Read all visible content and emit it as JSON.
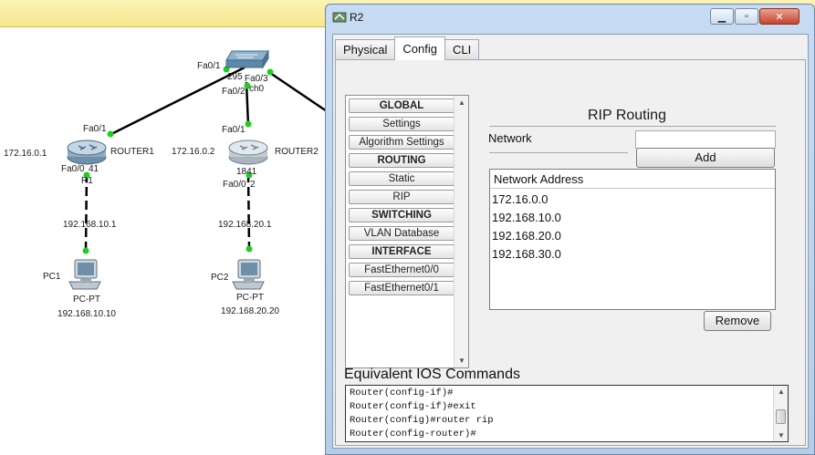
{
  "dialog": {
    "title": "R2",
    "tabs": [
      "Physical",
      "Config",
      "CLI"
    ],
    "active_tab": "Config"
  },
  "nav": {
    "items": [
      {
        "label": "GLOBAL",
        "header": true
      },
      {
        "label": "Settings",
        "header": false
      },
      {
        "label": "Algorithm Settings",
        "header": false
      },
      {
        "label": "ROUTING",
        "header": true
      },
      {
        "label": "Static",
        "header": false
      },
      {
        "label": "RIP",
        "header": false
      },
      {
        "label": "SWITCHING",
        "header": true
      },
      {
        "label": "VLAN Database",
        "header": false
      },
      {
        "label": "INTERFACE",
        "header": true
      },
      {
        "label": "FastEthernet0/0",
        "header": false
      },
      {
        "label": "FastEthernet0/1",
        "header": false
      }
    ]
  },
  "rip": {
    "title": "RIP Routing",
    "network_label": "Network",
    "network_value": "",
    "add_label": "Add",
    "list_header": "Network Address",
    "networks": [
      "172.16.0.0",
      "192.168.10.0",
      "192.168.20.0",
      "192.168.30.0"
    ],
    "remove_label": "Remove"
  },
  "ios": {
    "title": "Equivalent IOS Commands",
    "lines": [
      "Router(config-if)#",
      "Router(config-if)#exit",
      "Router(config)#router rip",
      "Router(config-router)#"
    ]
  },
  "topology": {
    "switch": {
      "name": "295",
      "name2": "ch0",
      "ports": [
        "Fa0/1",
        "Fa0/3",
        "Fa0/2"
      ]
    },
    "router1": {
      "name": "ROUTER1",
      "ip": "172.16.0.1",
      "port_top": "Fa0/1",
      "port_bottom": "Fa0/0",
      "model": "41",
      "model2": "R1"
    },
    "router2": {
      "name": "ROUTER2",
      "ip": "172.16.0.2",
      "port_top": "Fa0/1",
      "port_bottom": "Fa0/0",
      "model": "1841",
      "model2": "2"
    },
    "link1_ip": "192.168.10.1",
    "link2_ip": "192.168.20.1",
    "pc1": {
      "name": "PC1",
      "type": "PC-PT",
      "ip": "192.168.10.10"
    },
    "pc2": {
      "name": "PC2",
      "type": "PC-PT",
      "ip": "192.168.20.20"
    }
  },
  "colors": {
    "link_up": "#22cc22",
    "title_bar": "#c7dcf3",
    "top_strip": "#f6e78c"
  }
}
